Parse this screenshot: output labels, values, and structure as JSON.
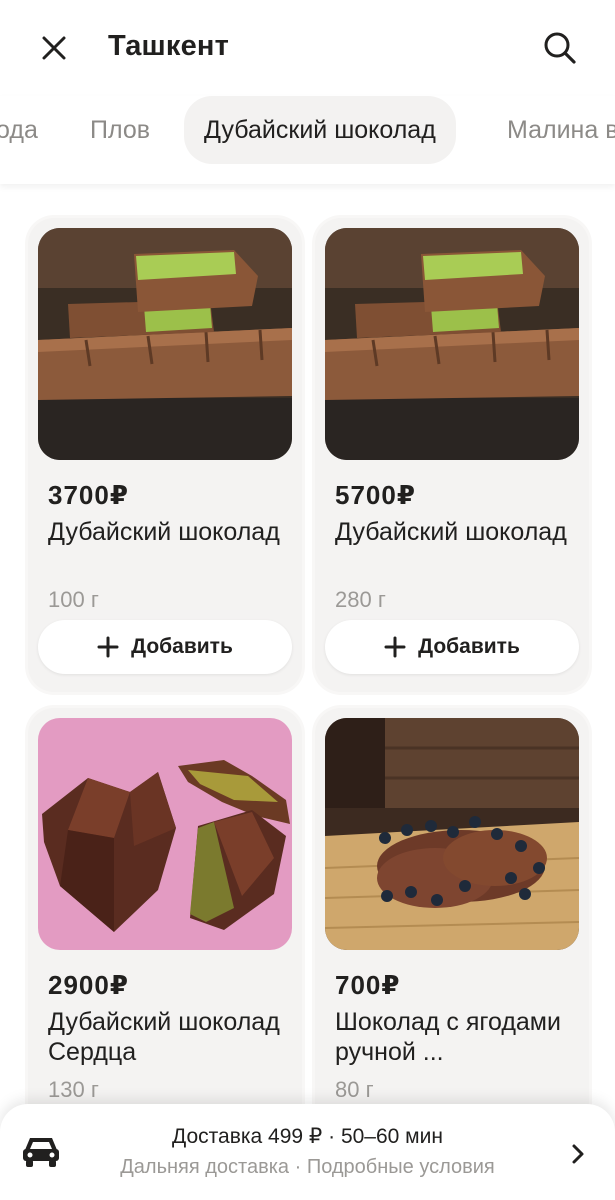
{
  "header": {
    "title": "Ташкент",
    "close_icon": "close-icon",
    "search_icon": "search-icon"
  },
  "tabs": [
    {
      "label": "Мёд и сладкие ягода",
      "shown": "ода",
      "active": false
    },
    {
      "label": "Плов",
      "shown": "Плов",
      "active": false
    },
    {
      "label": "Дубайский шоколад",
      "shown": "Дубайский шоколад",
      "active": true
    },
    {
      "label": "Малина",
      "shown": "Малина в",
      "active": false
    }
  ],
  "products": [
    {
      "price": "3700₽",
      "name": "Дубайский шоколад",
      "weight": "100 г",
      "add_label": "Добавить",
      "image": "chocolate-bar-pistachio"
    },
    {
      "price": "5700₽",
      "name": "Дубайский шоколад",
      "weight": "280 г",
      "add_label": "Добавить",
      "image": "chocolate-bar-pistachio"
    },
    {
      "price": "2900₽",
      "name": "Дубайский шоколад Сердца",
      "weight": "130 г",
      "add_label": "Добавить",
      "image": "chocolate-heart-pistachio"
    },
    {
      "price": "700₽",
      "name": "Шоколад с ягодами ручной ...",
      "weight": "80 г",
      "add_label": "Добавить",
      "image": "chocolate-berries"
    }
  ],
  "delivery": {
    "main": "Доставка 499 ₽ · 50–60 мин",
    "sub": "Дальняя доставка · Подробные условия",
    "icon": "car-icon"
  },
  "colors": {
    "text": "#21201f",
    "muted": "#9b9996",
    "card_bg": "#f4f3f2",
    "tab_active_bg": "#f3f2f1"
  }
}
